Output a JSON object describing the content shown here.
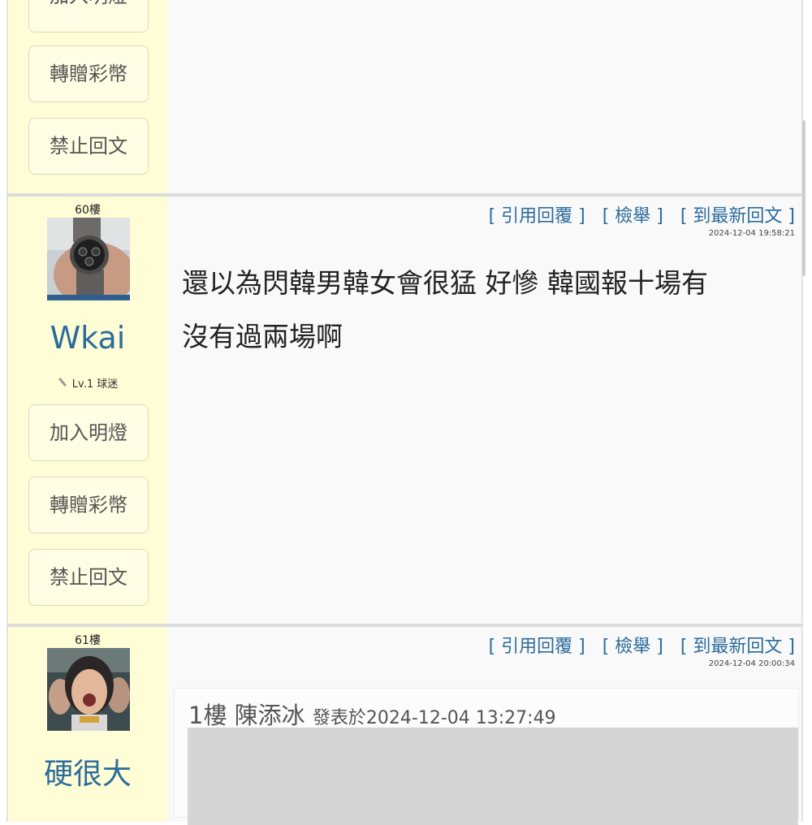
{
  "post_top": {
    "buttons": {
      "lamp": "加入明燈",
      "gift": "轉贈彩幣",
      "ban": "禁止回文"
    }
  },
  "post_60": {
    "floor": "60樓",
    "username": "Wkai",
    "level": "Lv.1 球迷",
    "actions": {
      "quote": "[ 引用回覆 ]",
      "report": "[ 檢舉 ]",
      "latest": "[ 到最新回文 ]"
    },
    "timestamp": "2024-12-04 19:58:21",
    "content_line1": "還以為閃韓男韓女會很猛 好慘 韓國報十場有",
    "content_line2": "沒有過兩場啊",
    "buttons": {
      "lamp": "加入明燈",
      "gift": "轉贈彩幣",
      "ban": "禁止回文"
    }
  },
  "post_61": {
    "floor": "61樓",
    "username": "硬很大",
    "actions": {
      "quote": "[ 引用回覆 ]",
      "report": "[ 檢舉 ]",
      "latest": "[ 到最新回文 ]"
    },
    "timestamp": "2024-12-04 20:00:34",
    "quote": {
      "floor": "1樓",
      "author": "陳添冰",
      "posted_prefix": "發表於",
      "posted_time": "2024-12-04 13:27:49"
    }
  },
  "colors": {
    "link": "#2b6c9c",
    "sidebar": "#fefdd6",
    "button_bg": "#fffde3"
  }
}
